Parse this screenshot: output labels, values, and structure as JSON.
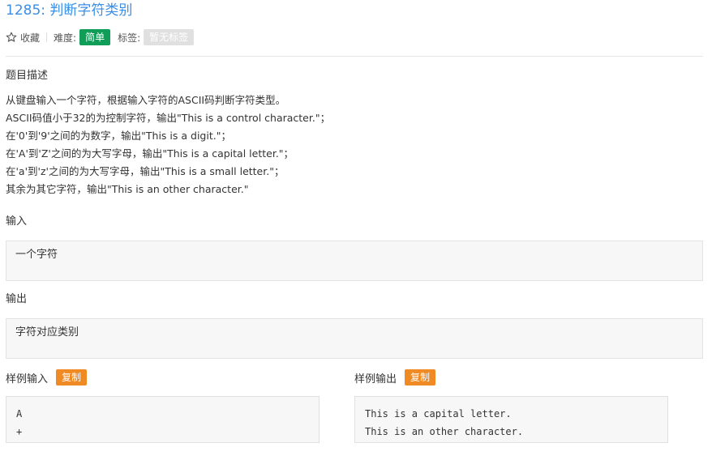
{
  "problem": {
    "title": "1285: 判断字符类别",
    "meta": {
      "favorite_label": "收藏",
      "difficulty_label": "难度:",
      "difficulty_value": "简单",
      "tags_label": "标签:",
      "tags_value": "暂无标签"
    }
  },
  "description": {
    "heading": "题目描述",
    "lines": [
      "从键盘输入一个字符，根据输入字符的ASCII码判断字符类型。",
      "ASCII码值小于32的为控制字符，输出\"This is a control character.\"；",
      "在'0'到'9'之间的为数字，输出\"This is a digit.\"；",
      "在'A'到'Z'之间的为大写字母，输出\"This is a capital letter.\"；",
      "在'a'到'z'之间的为大写字母，输出\"This is a small letter.\"；",
      "其余为其它字符，输出\"This is an other character.\""
    ]
  },
  "input_section": {
    "heading": "输入",
    "content": "一个字符"
  },
  "output_section": {
    "heading": "输出",
    "content": "字符对应类别"
  },
  "sample_input": {
    "heading": "样例输入",
    "copy_label": "复制",
    "lines": [
      "A",
      "+"
    ]
  },
  "sample_output": {
    "heading": "样例输出",
    "copy_label": "复制",
    "lines": [
      "This is a capital letter.",
      "This is an other character."
    ]
  },
  "colors": {
    "title": "#3a8ee6",
    "difficulty_badge": "#0f9d58",
    "tags_badge": "#e0e0e0",
    "copy_button": "#f08a24"
  },
  "icons": {
    "favorite": "star-outline-icon"
  }
}
